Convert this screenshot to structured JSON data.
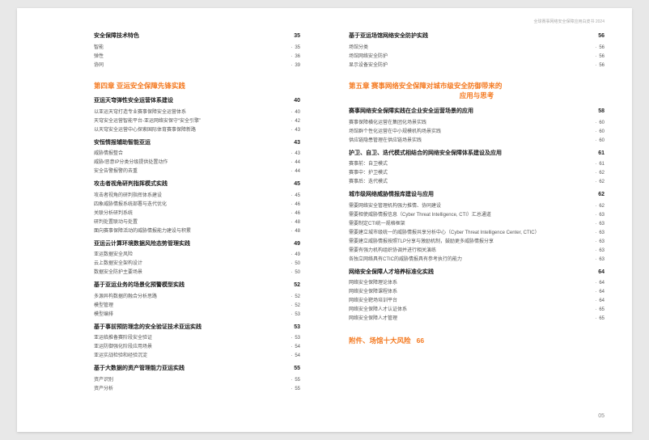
{
  "header": "全球赛事网络安全保障应用白皮书 2024",
  "pageNumber": "05",
  "left": {
    "sec0": {
      "title": "安全保障技术特色",
      "page": "35"
    },
    "sec0_subs": [
      {
        "t": "智能",
        "p": "35"
      },
      {
        "t": "弹性",
        "p": "36"
      },
      {
        "t": "协同",
        "p": "39"
      }
    ],
    "chapter4": "第四章  亚运安全保障先锋实践",
    "sec1": {
      "title": "亚运天穹弹性安全运营体系建设",
      "page": "40"
    },
    "sec1_subs": [
      {
        "t": "以亚运天穹打造专业赛事保障安全运营体系",
        "p": "40"
      },
      {
        "t": "天穹安全运营智能平台-亚运网络安保守“安全引擎”",
        "p": "42"
      },
      {
        "t": "以天穹安全运营中心探索国际体育赛事保障新路",
        "p": "43"
      }
    ],
    "sec2": {
      "title": "安恒情报辅助智能亚运",
      "page": "43"
    },
    "sec2_subs": [
      {
        "t": "威胁情报整合",
        "p": "43"
      },
      {
        "t": "威胁/恶意IP分类分级提供处置动作",
        "p": "44"
      },
      {
        "t": "安全告警报警的去重",
        "p": "44"
      }
    ],
    "sec3": {
      "title": "攻击者视角研判指挥模式实践",
      "page": "45"
    },
    "sec3_subs": [
      {
        "t": "攻击者视角的研判指挥体系建设",
        "p": "45"
      },
      {
        "t": "四象威胁情报系统部署与迭代优化",
        "p": "46"
      },
      {
        "t": "关联分析研判系统",
        "p": "46"
      },
      {
        "t": "研判处置联动与处置",
        "p": "48"
      },
      {
        "t": "面向赛事保障活动的威胁情报能力建设与积累",
        "p": "48"
      }
    ],
    "sec4": {
      "title": "亚运云计算环境数据风险态势管理实践",
      "page": "49"
    },
    "sec4_subs": [
      {
        "t": "亚运数据安全风险",
        "p": "49"
      },
      {
        "t": "云上数据安全架构设计",
        "p": "50"
      },
      {
        "t": "数据安全防护主要场景",
        "p": "50"
      }
    ],
    "sec5": {
      "title": "基于亚运业务的场景化预警模型实践",
      "page": "52"
    },
    "sec5_subs": [
      {
        "t": "多源异构数据的融合分析思路",
        "p": "52"
      },
      {
        "t": "模型管理",
        "p": "52"
      },
      {
        "t": "模型编排",
        "p": "53"
      }
    ],
    "sec6": {
      "title": "基于事前预防理念的安全验证技术亚运实践",
      "page": "53"
    },
    "sec6_subs": [
      {
        "t": "亚运临推备赛阶段安全验证",
        "p": "53"
      },
      {
        "t": "亚运防御强化阶段应用场景",
        "p": "54"
      },
      {
        "t": "亚运实战检验和经验沉淀",
        "p": "54"
      }
    ],
    "sec7": {
      "title": "基于大数据的资产管理能力亚运实践",
      "page": "55"
    },
    "sec7_subs": [
      {
        "t": "资产识别",
        "p": "55"
      },
      {
        "t": "资产分析",
        "p": "55"
      }
    ]
  },
  "right": {
    "sec0": {
      "title": "基于亚运场馆网络安全防护实践",
      "page": "56"
    },
    "sec0_subs": [
      {
        "t": "场馆分类",
        "p": "56"
      },
      {
        "t": "场馆网络安全防护",
        "p": "56"
      },
      {
        "t": "显示设备安全防护",
        "p": "56"
      }
    ],
    "chapter5a": "第五章  赛事网络安全保障对城市级安全防御带来的",
    "chapter5b": "应用与思考",
    "sec1": {
      "title": "赛事网络安全保障实践在企业安全运营场景的应用",
      "page": "58"
    },
    "sec1_subs": [
      {
        "t": "赛事保障横化运营在集团化场景实践",
        "p": "60"
      },
      {
        "t": "场馆群个性化运营在中小规模机构场景实践",
        "p": "60"
      },
      {
        "t": "供应链隐患管理在供应链场景实践",
        "p": "60"
      }
    ],
    "sec2": {
      "title": "护卫、自卫、迭代模式相结合的网络安全保障体系建设及应用",
      "page": "61"
    },
    "sec2_subs": [
      {
        "t": "赛事前：自卫模式",
        "p": "61"
      },
      {
        "t": "赛事中：护卫模式",
        "p": "62"
      },
      {
        "t": "赛事后：迭代模式",
        "p": "62"
      }
    ],
    "sec3": {
      "title": "城市级网络威胁情报库建设与应用",
      "page": "62"
    },
    "sec3_subs": [
      {
        "t": "需要网络安全管理机构强力推情、协同建设",
        "p": "62"
      },
      {
        "t": "需要相使威胁情报信息（Cyber Threat Intelligence, CTI）汇总通道",
        "p": "63"
      },
      {
        "t": "需要制定CTI统一规格框架",
        "p": "63"
      },
      {
        "t": "需要建立城市级统一的威胁情报共享分析中心（Cyber Threat Intelligence Center, CTIC）",
        "p": "63"
      },
      {
        "t": "需要建立威胁情报按照TLP分享与激励机制，鼓励更多威胁情报分享",
        "p": "63"
      },
      {
        "t": "需要有强力机构组织协调并进行相关演练",
        "p": "63"
      },
      {
        "t": "各独立网络具有CTIC的威胁情报具有参考执行的能力",
        "p": "63"
      }
    ],
    "sec4": {
      "title": "网络安全保障人才培养标准化实践",
      "page": "64"
    },
    "sec4_subs": [
      {
        "t": "网络安全保障理论体系",
        "p": "64"
      },
      {
        "t": "网络安全保障课程体系",
        "p": "64"
      },
      {
        "t": "网络安全靶场培训平台",
        "p": "64"
      },
      {
        "t": "网络安全保障人才认证体系",
        "p": "65"
      },
      {
        "t": "网络安全保障人才管理",
        "p": "65"
      }
    ],
    "appendix": {
      "label": "附件、场馆十大风险",
      "page": "66"
    }
  }
}
